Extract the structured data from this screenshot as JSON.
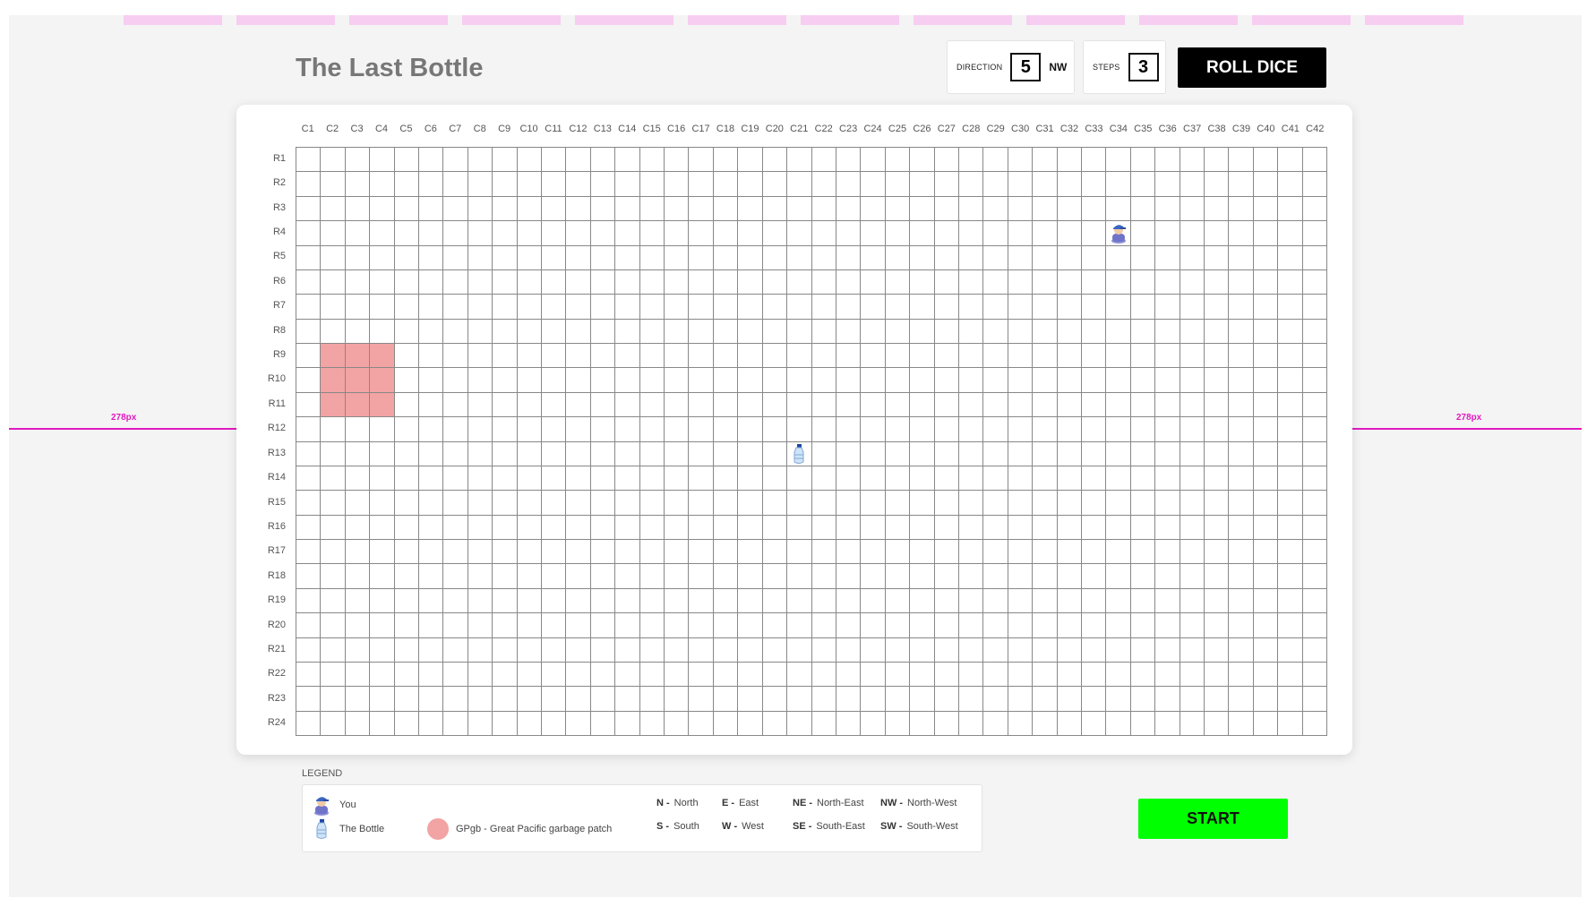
{
  "title": "The Last Bottle",
  "controls": {
    "direction_label": "DIRECTION",
    "direction_value": "5",
    "direction_code": "NW",
    "steps_label": "STEPS",
    "steps_value": "3",
    "roll_button": "ROLL DICE"
  },
  "measure": {
    "left_label": "278px",
    "right_label": "278px"
  },
  "board": {
    "columns": [
      "C1",
      "C2",
      "C3",
      "C4",
      "C5",
      "C6",
      "C7",
      "C8",
      "C9",
      "C10",
      "C11",
      "C12",
      "C13",
      "C14",
      "C15",
      "C16",
      "C17",
      "C18",
      "C19",
      "C20",
      "C21",
      "C22",
      "C23",
      "C24",
      "C25",
      "C26",
      "C27",
      "C28",
      "C29",
      "C30",
      "C31",
      "C32",
      "C33",
      "C34",
      "C35",
      "C36",
      "C37",
      "C38",
      "C39",
      "C40",
      "C41",
      "C42"
    ],
    "rows": [
      "R1",
      "R2",
      "R3",
      "R4",
      "R5",
      "R6",
      "R7",
      "R8",
      "R9",
      "R10",
      "R11",
      "R12",
      "R13",
      "R14",
      "R15",
      "R16",
      "R17",
      "R18",
      "R19",
      "R20",
      "R21",
      "R22",
      "R23",
      "R24"
    ],
    "garbage_cells": [
      [
        9,
        2
      ],
      [
        9,
        3
      ],
      [
        9,
        4
      ],
      [
        10,
        2
      ],
      [
        10,
        3
      ],
      [
        10,
        4
      ],
      [
        11,
        2
      ],
      [
        11,
        3
      ],
      [
        11,
        4
      ]
    ],
    "player": {
      "row": 4,
      "col": 34
    },
    "bottle": {
      "row": 13,
      "col": 21
    }
  },
  "legend": {
    "label": "LEGEND",
    "you": "You",
    "bottle": "The Bottle",
    "gpgb": "GPgb - Great Pacific garbage patch",
    "gpgb_color": "#f2a3a3",
    "directions": [
      {
        "abbr": "N -",
        "name": "North"
      },
      {
        "abbr": "E -",
        "name": "East"
      },
      {
        "abbr": "NE -",
        "name": "North-East"
      },
      {
        "abbr": "NW -",
        "name": "North-West"
      },
      {
        "abbr": "S -",
        "name": "South"
      },
      {
        "abbr": "W -",
        "name": "West"
      },
      {
        "abbr": "SE -",
        "name": "South-East"
      },
      {
        "abbr": "SW -",
        "name": "South-West"
      }
    ]
  },
  "start_button": "START"
}
